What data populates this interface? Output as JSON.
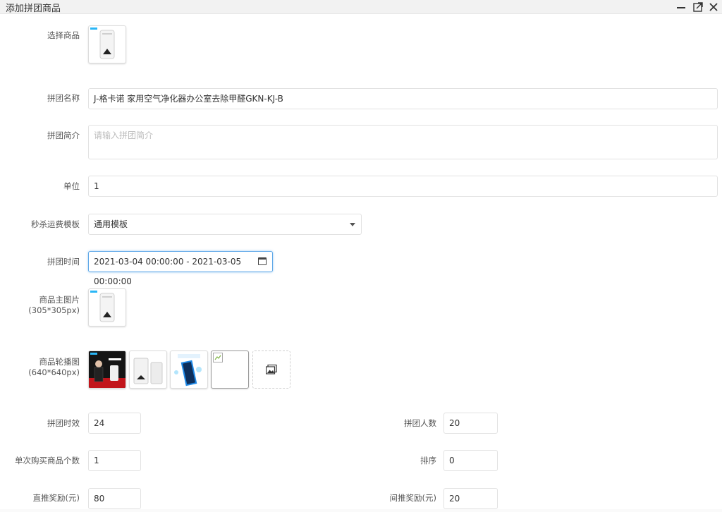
{
  "window": {
    "title": "添加拼团商品",
    "minimize_icon": "minimize-icon",
    "maximize_icon": "maximize-icon",
    "close_icon": "close-icon"
  },
  "form": {
    "select_product": {
      "label": "选择商品"
    },
    "group_name": {
      "label": "拼团名称",
      "value": "J-格卡诺 家用空气净化器办公室去除甲醛GKN-KJ-B"
    },
    "group_intro": {
      "label": "拼团简介",
      "placeholder": "请输入拼团简介",
      "value": ""
    },
    "unit": {
      "label": "单位",
      "value": "1"
    },
    "shipping_template": {
      "label": "秒杀运费模板",
      "selected": "通用模板"
    },
    "group_time": {
      "label": "拼团时间",
      "value": "2021-03-04 00:00:00 - 2021-03-05 00:00:00"
    },
    "main_image": {
      "label_line1": "商品主图片",
      "label_line2": "(305*305px)"
    },
    "carousel": {
      "label_line1": "商品轮播图",
      "label_line2": "(640*640px)",
      "count": 4,
      "add_icon": "image-upload-icon"
    },
    "duration": {
      "label": "拼团时效",
      "value": "24"
    },
    "group_size": {
      "label": "拼团人数",
      "value": "20"
    },
    "per_purchase": {
      "label": "单次购买商品个数",
      "value": "1"
    },
    "sort": {
      "label": "排序",
      "value": "0"
    },
    "direct_reward": {
      "label": "直推奖励(元)",
      "value": "80"
    },
    "indirect_reward": {
      "label": "间推奖励(元)",
      "value": "20"
    }
  },
  "colors": {
    "focus_border": "#5fa8e8",
    "tag": "#29b6f6"
  }
}
